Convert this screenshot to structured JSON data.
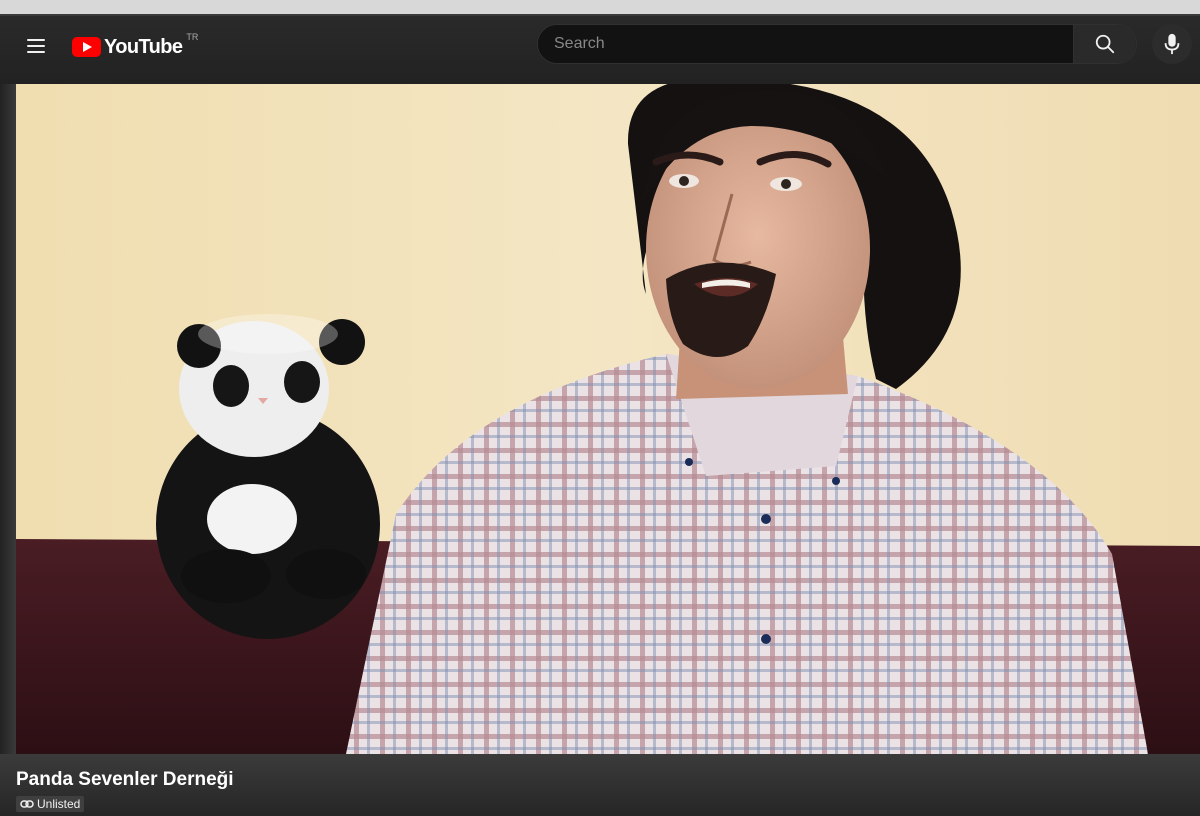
{
  "app": {
    "logo_text": "YouTube",
    "region_code": "TR",
    "brand_color": "#ff0000"
  },
  "masthead": {
    "menu_icon": "hamburger-menu-icon",
    "search_placeholder": "Search",
    "search_icon": "search-icon",
    "voice_icon": "microphone-icon"
  },
  "video": {
    "title": "Panda Sevenler Derneği",
    "visibility_label": "Unlisted",
    "visibility_icon": "link-icon"
  }
}
